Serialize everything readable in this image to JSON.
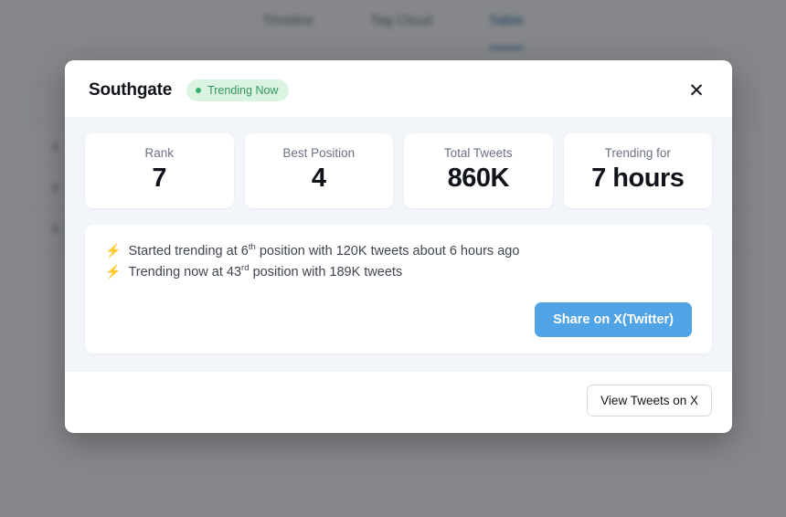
{
  "background": {
    "tabs": [
      {
        "label": "Timeline",
        "active": false
      },
      {
        "label": "Tag Cloud",
        "active": false
      },
      {
        "label": "Table",
        "active": true
      }
    ],
    "table_rows": [
      {
        "rank": "6",
        "name": "",
        "count": ""
      },
      {
        "rank": "8",
        "name": "",
        "count": ""
      },
      {
        "rank": "9",
        "name": "",
        "count": ""
      }
    ]
  },
  "modal": {
    "title": "Southgate",
    "badge": {
      "label": "Trending Now",
      "dot_color": "#3cb06a",
      "bg_color": "#dbf4e2",
      "text_color": "#35955c"
    },
    "close_icon": "close-icon",
    "close_glyph": "✕",
    "stats": [
      {
        "label": "Rank",
        "value": "7"
      },
      {
        "label": "Best Position",
        "value": "4"
      },
      {
        "label": "Total Tweets",
        "value": "860K"
      },
      {
        "label": "Trending for",
        "value": "7 hours"
      }
    ],
    "details": [
      {
        "bolt": "⚡",
        "pre": "Started trending at 6",
        "ordinal": "th",
        "post": " position with 120K tweets about 6 hours ago"
      },
      {
        "bolt": "⚡",
        "pre": "Trending now at 43",
        "ordinal": "rd",
        "post": " position with 189K tweets"
      }
    ],
    "share_label": "Share on X(Twitter)",
    "share_color": "#50a4e6",
    "footer_label": "View Tweets on X"
  }
}
